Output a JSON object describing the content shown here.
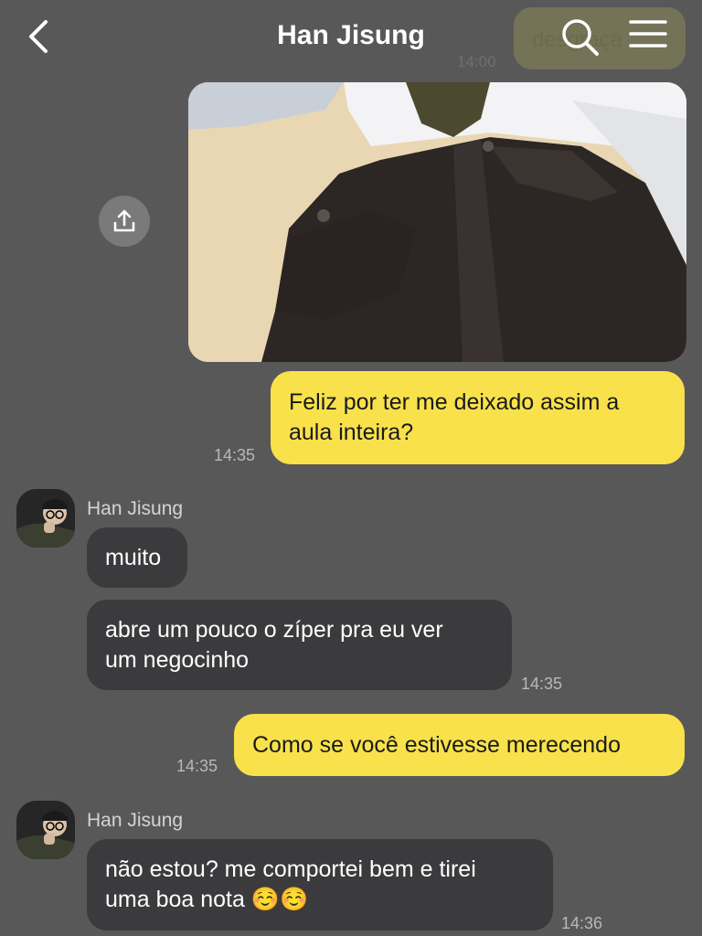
{
  "header": {
    "title": "Han Jisung",
    "back_icon": "chevron-left-icon",
    "search_icon": "search-icon",
    "menu_icon": "hamburger-menu-icon"
  },
  "previous": {
    "bubble_text": "desgraça",
    "time": "14:00"
  },
  "messages": [
    {
      "kind": "photo",
      "side": "sent",
      "description_icon": "share-upload-icon"
    },
    {
      "kind": "text",
      "side": "sent",
      "text_lines": [
        "Feliz por ter me deixado assim a",
        "aula inteira?"
      ],
      "time": "14:35"
    },
    {
      "kind": "sender",
      "name": "Han Jisung"
    },
    {
      "kind": "text",
      "side": "received",
      "text_lines": [
        "muito"
      ]
    },
    {
      "kind": "text",
      "side": "received",
      "text_lines": [
        "abre um pouco o zíper pra eu ver",
        "um negocinho"
      ],
      "time": "14:35"
    },
    {
      "kind": "text",
      "side": "sent",
      "text_lines": [
        "Como se você estivesse merecendo"
      ],
      "time": "14:35"
    },
    {
      "kind": "sender",
      "name": "Han Jisung"
    },
    {
      "kind": "text",
      "side": "received",
      "text_lines": [
        "não estou? me comportei bem e tirei",
        "uma boa nota ☺️☺️"
      ],
      "time": "14:36"
    }
  ],
  "colors": {
    "background": "#585858",
    "sent_bubble": "#f8e14b",
    "received_bubble": "#3b3b3d",
    "timestamp": "#b8b8b8"
  }
}
